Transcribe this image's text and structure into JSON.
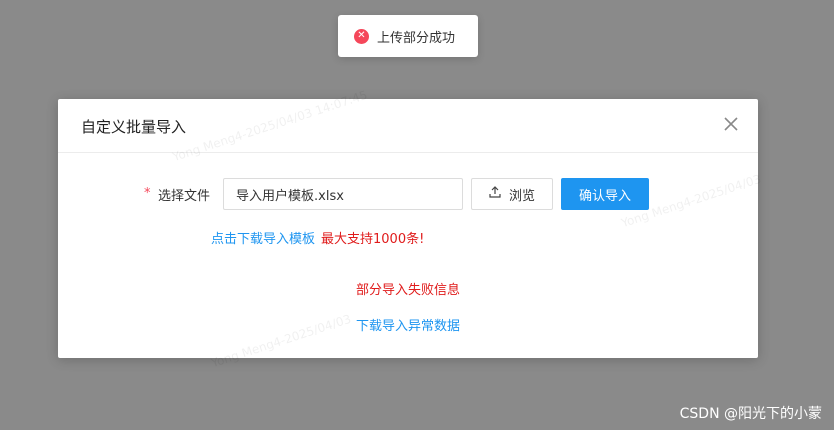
{
  "toast": {
    "icon": "error-circle-icon",
    "message": "上传部分成功",
    "color": "#f5475a"
  },
  "dialog": {
    "title": "自定义批量导入",
    "watermarks": [
      "Yong Meng4-2025/04/03  14:07:45",
      "Yong Meng4-2025/04/03",
      "Yong Meng4-2025/04/03"
    ],
    "form": {
      "required_mark": "*",
      "label": "选择文件",
      "file_value": "导入用户模板.xlsx",
      "browse_label": "浏览",
      "confirm_label": "确认导入"
    },
    "download_template_label": "点击下载导入模板",
    "max_support_text": "最大支持1000条!",
    "fail_info_text": "部分导入失败信息",
    "download_error_label": "下载导入异常数据"
  },
  "footer_watermark": "CSDN @阳光下的小蒙",
  "colors": {
    "accent": "#1e95f0",
    "danger": "#e01b1b",
    "overlay": "#8a8a8a"
  }
}
